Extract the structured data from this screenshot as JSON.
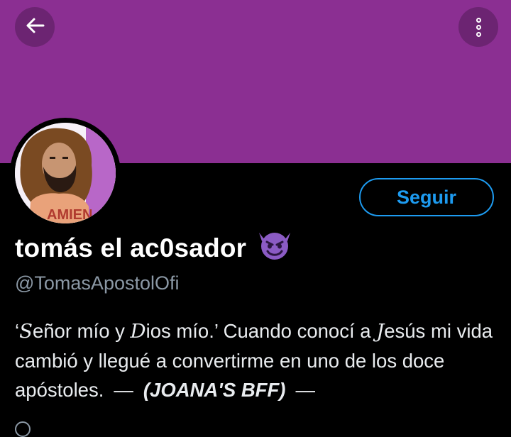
{
  "colors": {
    "banner": "#8b2f92",
    "background": "#000000",
    "accent": "#1d9bf0",
    "secondary_text": "#8b98a5",
    "emoji": "#8b5bc4"
  },
  "header": {
    "back_icon": "arrow-left-icon",
    "more_icon": "more-vertical-icon"
  },
  "profile": {
    "display_name": "tomás el ac0sador",
    "name_emoji": "smiling-devil-icon",
    "handle": "@TomasApostolOfi",
    "avatar_caption": "AMIEN",
    "follow_label": "Seguir"
  },
  "bio": {
    "quote_open": "‘",
    "s_script": "S",
    "part1": "eñor mío y ",
    "d_script": "D",
    "part2": "ios mío.",
    "quote_close": "’",
    "part3": " Cuando conocí a ",
    "j_script": "J",
    "part4": "esús mi vida cambió y llegué a convertirme en uno de los doce apóstoles.",
    "dash1": "—",
    "bff": "(JOANA'S BFF)",
    "dash2": "—"
  }
}
